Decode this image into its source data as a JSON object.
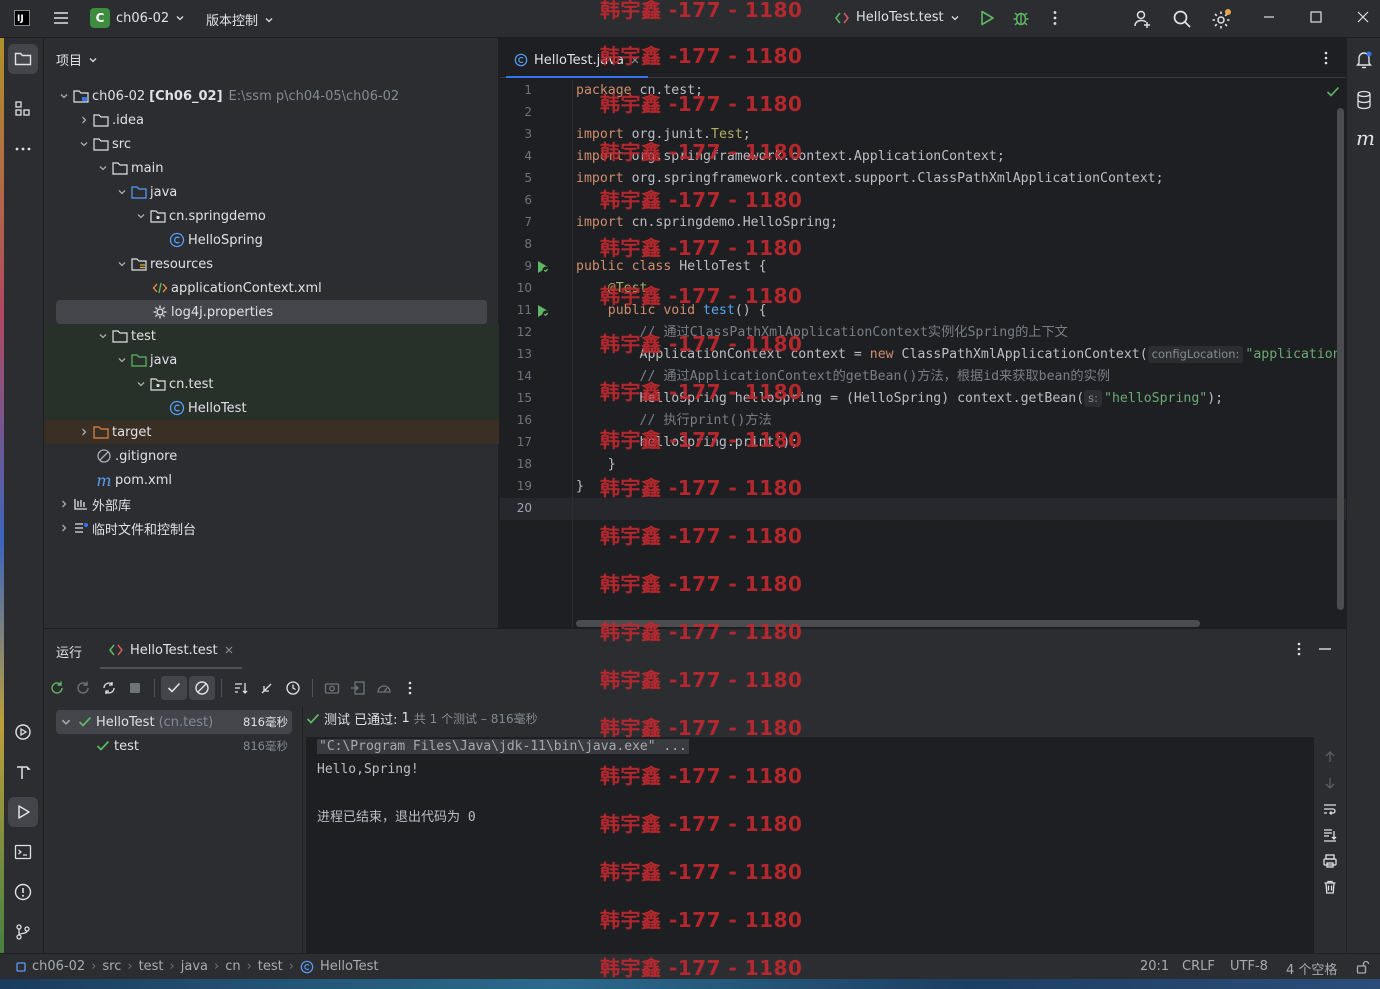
{
  "titlebar": {
    "app_icon": "intellij-logo",
    "project_badge": "C",
    "project_name": "ch06-02",
    "vcs_menu": "版本控制",
    "run_config": "HelloTest.test"
  },
  "project_panel": {
    "title": "项目",
    "tree": [
      {
        "label": "ch06-02",
        "bold": "[Ch06_02]",
        "path": "E:\\ssm p\\ch04-05\\ch06-02"
      },
      {
        "label": ".idea"
      },
      {
        "label": "src"
      },
      {
        "label": "main"
      },
      {
        "label": "java"
      },
      {
        "label": "cn.springdemo"
      },
      {
        "label": "HelloSpring"
      },
      {
        "label": "resources"
      },
      {
        "label": "applicationContext.xml"
      },
      {
        "label": "log4j.properties"
      },
      {
        "label": "test"
      },
      {
        "label": "java"
      },
      {
        "label": "cn.test"
      },
      {
        "label": "HelloTest"
      },
      {
        "label": "target"
      },
      {
        "label": ".gitignore"
      },
      {
        "label": "pom.xml"
      },
      {
        "label": "外部库"
      },
      {
        "label": "临时文件和控制台"
      }
    ]
  },
  "editor": {
    "tab_label": "HelloTest.java",
    "line_numbers": [
      "1",
      "2",
      "3",
      "4",
      "5",
      "6",
      "7",
      "8",
      "9",
      "10",
      "11",
      "12",
      "13",
      "14",
      "15",
      "16",
      "17",
      "18",
      "19",
      "20"
    ],
    "code": {
      "l1": "package cn.test;",
      "l3a": "import org.junit.",
      "l3b": "Test",
      "l3c": ";",
      "l4": "import org.springframework.context.ApplicationContext;",
      "l5": "import org.springframework.context.support.ClassPathXmlApplicationContext;",
      "l7": "import cn.springdemo.HelloSpring;",
      "l9a": "public class",
      "l9b": " HelloTest {",
      "l10": "    @Test",
      "l11a": "    public void",
      "l11b": "test",
      "l11c": "() {",
      "l12": "        // 通过ClassPathXmlApplicationContext实例化Spring的上下文",
      "l13a": "        ApplicationContext context = ",
      "l13b": "new",
      "l13c": " ClassPathXmlApplicationContext(",
      "l13hint": "configLocation:",
      "l13str": "\"applicationContext.xml\");",
      "l14": "        // 通过ApplicationContext的getBean()方法，根据id来获取bean的实例",
      "l15a": "        HelloSpring helloSpring = (HelloSpring) context.getBean(",
      "l15hint": "s:",
      "l15str": "\"helloSpring\"",
      "l15c": ");",
      "l16": "        // 执行print()方法",
      "l17": "        helloSpring.print();",
      "l18": "    }",
      "l19": "}"
    }
  },
  "run_panel": {
    "title": "运行",
    "tab_label": "HelloTest.test",
    "test_tree": [
      {
        "label": "HelloTest",
        "pkg": "(cn.test)",
        "time": "816毫秒"
      },
      {
        "label": "test",
        "time": "816毫秒"
      }
    ],
    "result": {
      "prefix": "测试 已通过:",
      "count": "1",
      "suffix": "共 1 个测试 – 816毫秒"
    },
    "console": {
      "cmd": "\"C:\\Program Files\\Java\\jdk-11\\bin\\java.exe\" ...",
      "out1": "Hello,Spring!",
      "out2": "进程已结束，退出代码为 0"
    }
  },
  "statusbar": {
    "breadcrumbs": [
      "ch06-02",
      "src",
      "test",
      "java",
      "cn",
      "test",
      "HelloTest"
    ],
    "position": "20:1",
    "line_sep": "CRLF",
    "encoding": "UTF-8",
    "indent": "4 个空格"
  },
  "watermark": "韩宇鑫 -177 - 1180",
  "colors": {
    "accent": "#3574f0",
    "success": "#5fb865",
    "watermark": "#c0282f"
  }
}
